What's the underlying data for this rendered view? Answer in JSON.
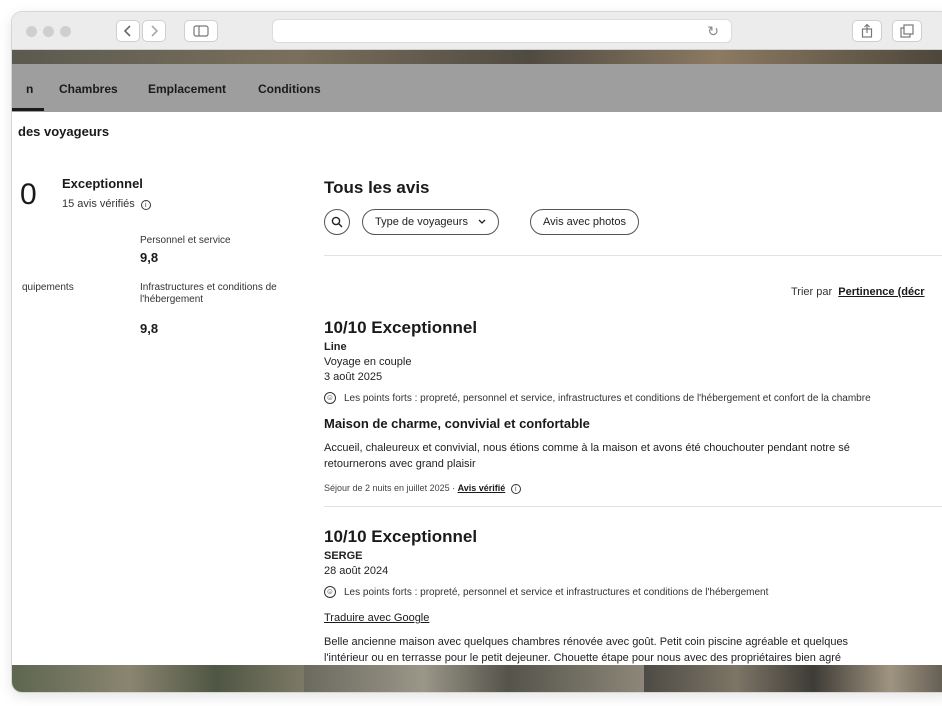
{
  "browser": {
    "back_icon": "chevron-left",
    "forward_icon": "chevron-right",
    "sidebar_icon": "sidebar",
    "reload_icon": "reload",
    "share_icon": "share",
    "tabs_icon": "tabs"
  },
  "nav": {
    "tabs": [
      "n",
      "Chambres",
      "Emplacement",
      "Conditions"
    ]
  },
  "section_title": "des voyageurs",
  "summary": {
    "score": "0",
    "label": "Exceptionnel",
    "count": "15 avis vérifiés",
    "categories": [
      {
        "name": "Personnel et service",
        "score": "9,8"
      },
      {
        "name": "quipements",
        "score": ""
      },
      {
        "name": "Infrastructures et conditions de l'hébergement",
        "score": "9,8"
      }
    ]
  },
  "reviews_panel": {
    "title": "Tous les avis",
    "filters": [
      "Type de voyageurs",
      "Avis avec photos"
    ],
    "sort_label": "Trier par",
    "sort_value": "Pertinence (décr"
  },
  "reviews": [
    {
      "rating": "10/10 Exceptionnel",
      "author": "Line",
      "trip_type": "Voyage en couple",
      "date": "3 août 2025",
      "highlights": "Les points forts : propreté, personnel et service, infrastructures et conditions de l'hébergement et confort de la chambre",
      "title": "Maison de charme, convivial et confortable",
      "body_line1": "Accueil, chaleureux et convivial, nous étions comme à la maison et avons été chouchouter pendant notre sé",
      "body_line2": "retournerons avec grand plaisir",
      "stay": "Séjour de 2 nuits en juillet 2025",
      "verified": "Avis vérifié"
    },
    {
      "rating": "10/10 Exceptionnel",
      "author": "SERGE",
      "date": "28 août 2024",
      "highlights": "Les points forts : propreté, personnel et service et infrastructures et conditions de l'hébergement",
      "translate": "Traduire avec Google",
      "body_line1": "Belle ancienne maison avec quelques chambres rénovée avec goût. Petit coin piscine agréable et quelques",
      "body_line2": "l'intérieur ou en terrasse pour le petit dejeuner. Chouette étape pour nous avec des propriétaires bien agré"
    }
  ]
}
